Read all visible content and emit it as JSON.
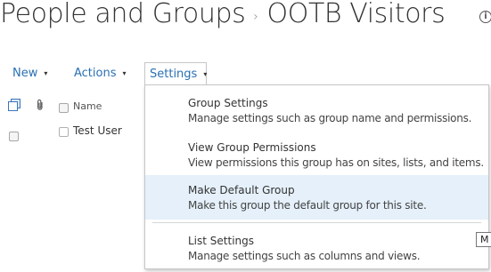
{
  "title": {
    "site": "People and Groups",
    "separator": "›",
    "group": "OOTB Visitors"
  },
  "toolbar": {
    "new_label": "New",
    "actions_label": "Actions",
    "settings_label": "Settings",
    "caret": "▾"
  },
  "list": {
    "columns": {
      "name": "Name"
    },
    "rows": [
      {
        "name": "Test User"
      }
    ]
  },
  "settings_menu": {
    "items": [
      {
        "title": "Group Settings",
        "description": "Manage settings such as group name and permissions."
      },
      {
        "title": "View Group Permissions",
        "description": "View permissions this group has on sites, lists, and items."
      },
      {
        "title": "Make Default Group",
        "description": "Make this group the default group for this site."
      },
      {
        "title": "List Settings",
        "description": "Manage settings such as columns and views."
      }
    ],
    "highlighted_index": 2
  },
  "tooltip": {
    "text": "M"
  },
  "colors": {
    "link": "#2a6fb3",
    "highlight": "#e5f0fa"
  },
  "icons": {
    "info": "info-icon",
    "select_all": "select-all-icon",
    "attachment": "attachment-icon"
  }
}
